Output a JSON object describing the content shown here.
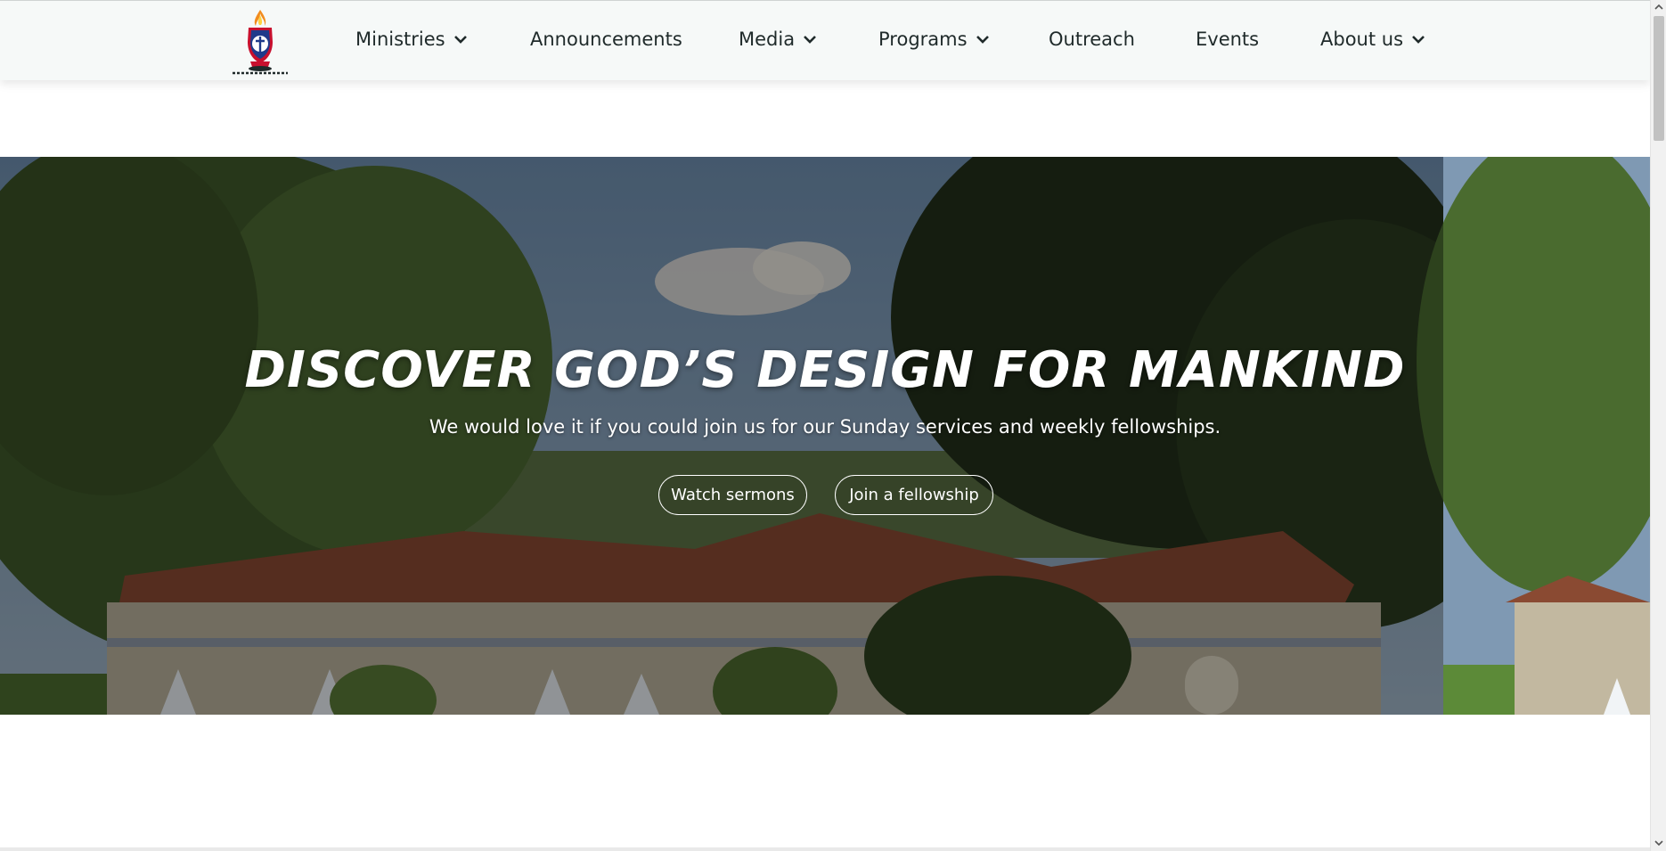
{
  "header": {
    "logo_icon": "church-crest-logo-icon",
    "nav": [
      {
        "label": "Ministries",
        "dropdown": true
      },
      {
        "label": "Announcements",
        "dropdown": false
      },
      {
        "label": "Media",
        "dropdown": true
      },
      {
        "label": "Programs",
        "dropdown": true
      },
      {
        "label": "Outreach",
        "dropdown": false
      },
      {
        "label": "Events",
        "dropdown": false
      },
      {
        "label": "About us",
        "dropdown": true
      }
    ]
  },
  "hero": {
    "title": "DISCOVER GOD’S DESIGN FOR MANKIND",
    "subtitle": "We would love it if you could join us for our Sunday services and weekly fellowships.",
    "buttons": [
      {
        "label": "Watch sermons"
      },
      {
        "label": "Join a fellowship"
      }
    ]
  },
  "colors": {
    "header_bg": "#f6f9f8",
    "nav_text": "#1f2a2a",
    "hero_text": "#ffffff",
    "logo_red": "#c8102e",
    "logo_blue": "#1f3a8a"
  }
}
